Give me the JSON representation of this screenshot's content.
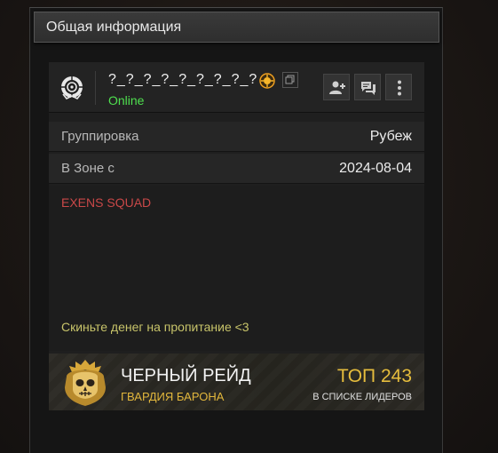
{
  "panel": {
    "title": "Общая информация"
  },
  "profile": {
    "username": "?_?_?_?_?_?_?_?_?",
    "status": "Online",
    "avatar_icon": "clan-emblem-icon",
    "badge_icon": "gold-badge-icon",
    "copy_icon": "copy-icon",
    "actions": [
      {
        "icon": "add-friend-icon"
      },
      {
        "icon": "chat-icon"
      },
      {
        "icon": "more-vertical-icon"
      }
    ]
  },
  "info": {
    "faction_label": "Группировка",
    "faction_value": "Рубеж",
    "zone_label": "В Зоне с",
    "zone_value": "2024-08-04"
  },
  "bio": {
    "title": "EXENS SQUAD",
    "text": "Скиньте денег на пропитание <3"
  },
  "raid": {
    "title": "ЧЕРНЫЙ РЕЙД",
    "subtitle": "ГВАРДИЯ БАРОНА",
    "rank": "ТОП 243",
    "rank_subtitle": "В СПИСКЕ ЛИДЕРОВ",
    "emblem_icon": "skull-crest-icon"
  },
  "colors": {
    "online": "#4fe04f",
    "bio_title": "#c94848",
    "bio_text": "#c8c46a",
    "gold": "#e6bd3d"
  }
}
